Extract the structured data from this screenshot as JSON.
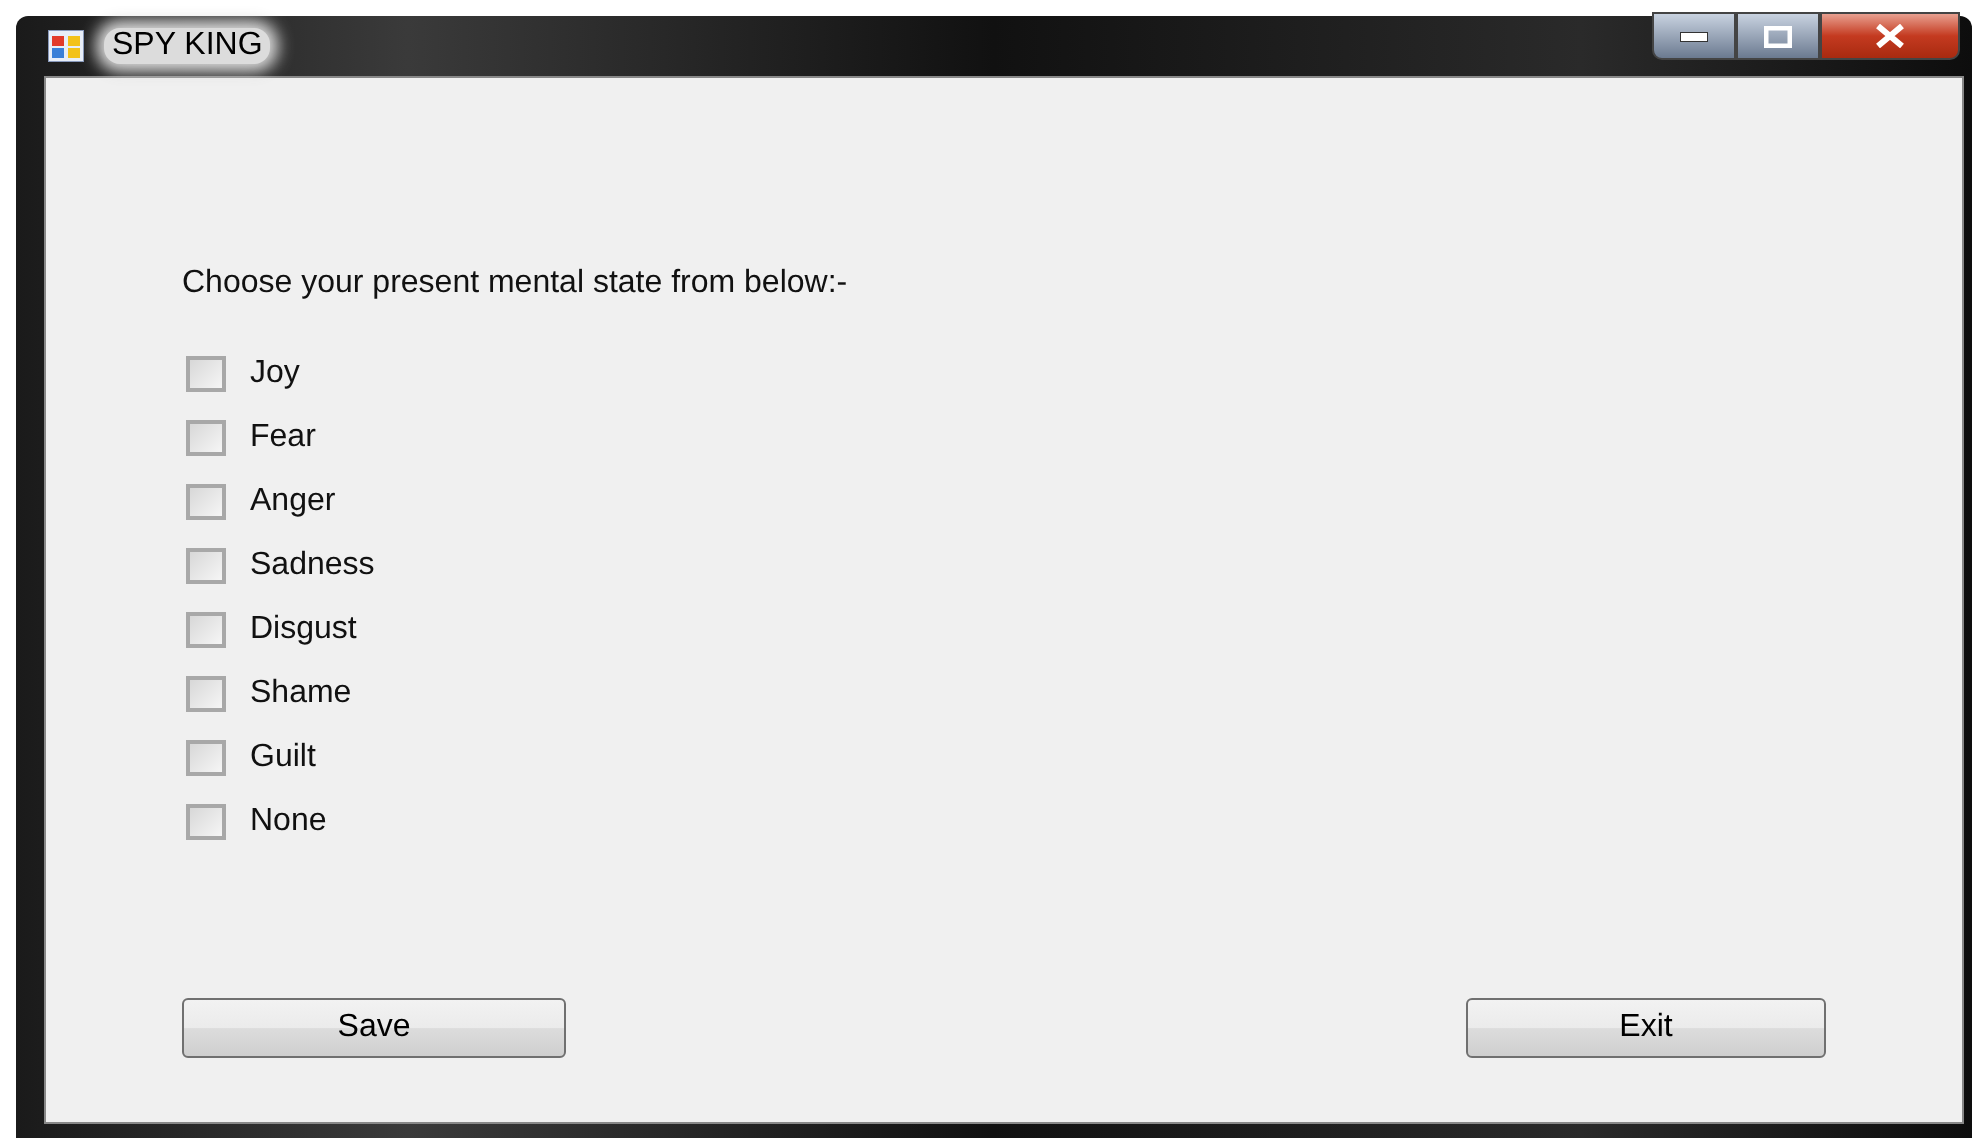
{
  "window": {
    "title": "SPY KING"
  },
  "prompt": "Choose your present mental state from below:-",
  "options": [
    {
      "label": "Joy",
      "checked": false
    },
    {
      "label": "Fear",
      "checked": false
    },
    {
      "label": "Anger",
      "checked": false
    },
    {
      "label": "Sadness",
      "checked": false
    },
    {
      "label": "Disgust",
      "checked": false
    },
    {
      "label": "Shame",
      "checked": false
    },
    {
      "label": "Guilt",
      "checked": false
    },
    {
      "label": "None",
      "checked": false
    }
  ],
  "buttons": [
    {
      "label": "Save"
    },
    {
      "label": "Exit"
    }
  ]
}
